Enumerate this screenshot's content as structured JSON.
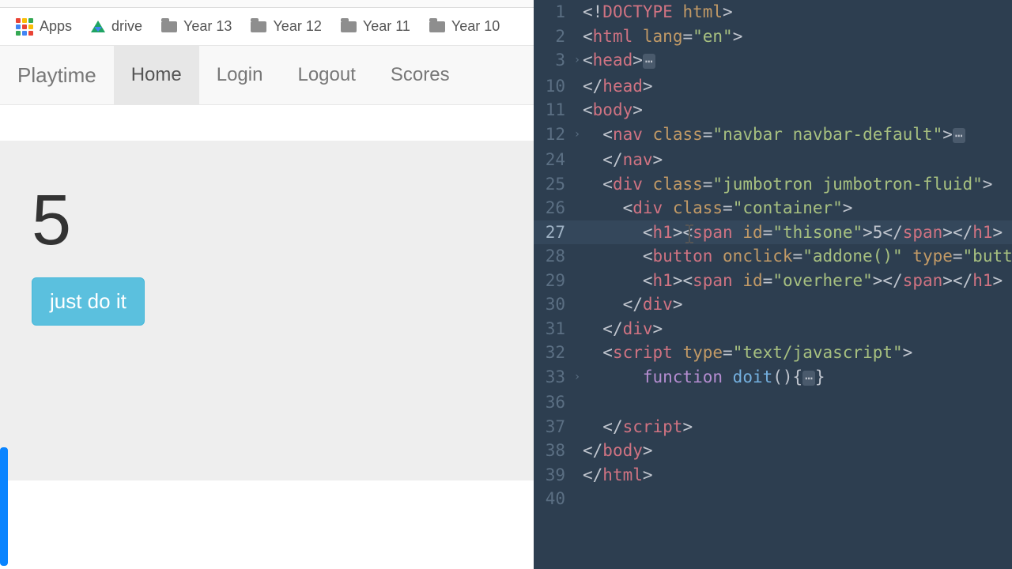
{
  "bookmarks": {
    "apps": "Apps",
    "drive": "drive",
    "folders": [
      "Year 13",
      "Year 12",
      "Year 11",
      "Year 10"
    ]
  },
  "navbar": {
    "brand": "Playtime",
    "links": [
      "Home",
      "Login",
      "Logout",
      "Scores"
    ],
    "active_index": 0
  },
  "jumbotron": {
    "counter_value": "5",
    "button_label": "just do it"
  },
  "editor": {
    "lines": [
      {
        "n": 1,
        "fold": "",
        "indent": 0,
        "tokens": [
          [
            "p",
            "<!"
          ],
          [
            "tag",
            "DOCTYPE"
          ],
          [
            "p",
            " "
          ],
          [
            "attr",
            "html"
          ],
          [
            "p",
            ">"
          ]
        ]
      },
      {
        "n": 2,
        "fold": "",
        "indent": 0,
        "tokens": [
          [
            "p",
            "<"
          ],
          [
            "tag",
            "html"
          ],
          [
            "p",
            " "
          ],
          [
            "attr",
            "lang"
          ],
          [
            "p",
            "="
          ],
          [
            "str",
            "\"en\""
          ],
          [
            "p",
            ">"
          ]
        ]
      },
      {
        "n": 3,
        "fold": "›",
        "indent": 0,
        "tokens": [
          [
            "p",
            "<"
          ],
          [
            "tag",
            "head"
          ],
          [
            "p",
            ">"
          ],
          [
            "ellip",
            "…"
          ]
        ]
      },
      {
        "n": 10,
        "fold": "",
        "indent": 0,
        "tokens": [
          [
            "p",
            "</"
          ],
          [
            "tag",
            "head"
          ],
          [
            "p",
            ">"
          ]
        ]
      },
      {
        "n": 11,
        "fold": "",
        "indent": 0,
        "tokens": [
          [
            "p",
            "<"
          ],
          [
            "tag",
            "body"
          ],
          [
            "p",
            ">"
          ]
        ]
      },
      {
        "n": 12,
        "fold": "›",
        "indent": 1,
        "tokens": [
          [
            "p",
            "<"
          ],
          [
            "tag",
            "nav"
          ],
          [
            "p",
            " "
          ],
          [
            "attr",
            "class"
          ],
          [
            "p",
            "="
          ],
          [
            "str",
            "\"navbar navbar-default\""
          ],
          [
            "p",
            ">"
          ],
          [
            "ellip",
            "…"
          ]
        ]
      },
      {
        "n": 24,
        "fold": "",
        "indent": 1,
        "tokens": [
          [
            "p",
            "</"
          ],
          [
            "tag",
            "nav"
          ],
          [
            "p",
            ">"
          ]
        ]
      },
      {
        "n": 25,
        "fold": "",
        "indent": 1,
        "tokens": [
          [
            "p",
            "<"
          ],
          [
            "tag",
            "div"
          ],
          [
            "p",
            " "
          ],
          [
            "attr",
            "class"
          ],
          [
            "p",
            "="
          ],
          [
            "str",
            "\"jumbotron jumbotron-fluid\""
          ],
          [
            "p",
            ">"
          ]
        ]
      },
      {
        "n": 26,
        "fold": "",
        "indent": 2,
        "tokens": [
          [
            "p",
            "<"
          ],
          [
            "tag",
            "div"
          ],
          [
            "p",
            " "
          ],
          [
            "attr",
            "class"
          ],
          [
            "p",
            "="
          ],
          [
            "str",
            "\"container\""
          ],
          [
            "p",
            ">"
          ]
        ]
      },
      {
        "n": 27,
        "fold": "",
        "indent": 3,
        "current": true,
        "caret_after": 0,
        "tokens": [
          [
            "p",
            "<"
          ],
          [
            "tag",
            "h1"
          ],
          [
            "p",
            ">"
          ],
          [
            "p",
            "<"
          ],
          [
            "tag",
            "span"
          ],
          [
            "p",
            " "
          ],
          [
            "attr",
            "id"
          ],
          [
            "p",
            "="
          ],
          [
            "str",
            "\"thisone\""
          ],
          [
            "p",
            ">"
          ],
          [
            "p",
            "5"
          ],
          [
            "p",
            "</"
          ],
          [
            "tag",
            "span"
          ],
          [
            "p",
            ">"
          ],
          [
            "p",
            "</"
          ],
          [
            "tag",
            "h1"
          ],
          [
            "p",
            ">"
          ]
        ]
      },
      {
        "n": 28,
        "fold": "",
        "indent": 3,
        "tokens": [
          [
            "p",
            "<"
          ],
          [
            "tag",
            "button"
          ],
          [
            "p",
            " "
          ],
          [
            "attr",
            "onclick"
          ],
          [
            "p",
            "="
          ],
          [
            "str",
            "\"addone()\""
          ],
          [
            "p",
            " "
          ],
          [
            "attr",
            "type"
          ],
          [
            "p",
            "="
          ],
          [
            "str",
            "\"butto"
          ]
        ]
      },
      {
        "n": 29,
        "fold": "",
        "indent": 3,
        "tokens": [
          [
            "p",
            "<"
          ],
          [
            "tag",
            "h1"
          ],
          [
            "p",
            ">"
          ],
          [
            "p",
            "<"
          ],
          [
            "tag",
            "span"
          ],
          [
            "p",
            " "
          ],
          [
            "attr",
            "id"
          ],
          [
            "p",
            "="
          ],
          [
            "str",
            "\"overhere\""
          ],
          [
            "p",
            ">"
          ],
          [
            "p",
            "</"
          ],
          [
            "tag",
            "span"
          ],
          [
            "p",
            ">"
          ],
          [
            "p",
            "</"
          ],
          [
            "tag",
            "h1"
          ],
          [
            "p",
            ">"
          ]
        ]
      },
      {
        "n": 30,
        "fold": "",
        "indent": 2,
        "tokens": [
          [
            "p",
            "</"
          ],
          [
            "tag",
            "div"
          ],
          [
            "p",
            ">"
          ]
        ]
      },
      {
        "n": 31,
        "fold": "",
        "indent": 1,
        "tokens": [
          [
            "p",
            "</"
          ],
          [
            "tag",
            "div"
          ],
          [
            "p",
            ">"
          ]
        ]
      },
      {
        "n": 32,
        "fold": "",
        "indent": 1,
        "tokens": [
          [
            "p",
            "<"
          ],
          [
            "tag",
            "script"
          ],
          [
            "p",
            " "
          ],
          [
            "attr",
            "type"
          ],
          [
            "p",
            "="
          ],
          [
            "str",
            "\"text/javascript\""
          ],
          [
            "p",
            ">"
          ]
        ]
      },
      {
        "n": 33,
        "fold": "›",
        "indent": 3,
        "tokens": [
          [
            "kw",
            "function"
          ],
          [
            "p",
            " "
          ],
          [
            "fn",
            "doit"
          ],
          [
            "p",
            "(){"
          ],
          [
            "ellip",
            "…"
          ],
          [
            "p",
            "}"
          ]
        ]
      },
      {
        "n": 36,
        "fold": "",
        "indent": 0,
        "tokens": []
      },
      {
        "n": 37,
        "fold": "",
        "indent": 1,
        "tokens": [
          [
            "p",
            "</"
          ],
          [
            "tag",
            "script"
          ],
          [
            "p",
            ">"
          ]
        ]
      },
      {
        "n": 38,
        "fold": "",
        "indent": 0,
        "tokens": [
          [
            "p",
            "</"
          ],
          [
            "tag",
            "body"
          ],
          [
            "p",
            ">"
          ]
        ]
      },
      {
        "n": 39,
        "fold": "",
        "indent": 0,
        "tokens": [
          [
            "p",
            "</"
          ],
          [
            "tag",
            "html"
          ],
          [
            "p",
            ">"
          ]
        ]
      },
      {
        "n": 40,
        "fold": "",
        "indent": 0,
        "tokens": []
      }
    ]
  }
}
